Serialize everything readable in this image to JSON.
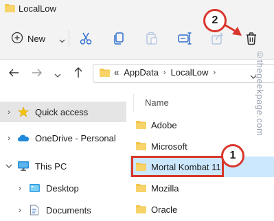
{
  "window": {
    "title": "LocalLow"
  },
  "toolbar": {
    "new_label": "New",
    "buttons": [
      "cut-icon",
      "copy-icon",
      "paste-icon",
      "rename-icon",
      "share-icon",
      "delete-icon"
    ]
  },
  "address": {
    "overflow": "«",
    "crumbs": [
      "AppData",
      "LocalLow"
    ]
  },
  "nav": {
    "items": [
      {
        "label": "Quick access",
        "icon": "star-icon",
        "selected": true
      },
      {
        "label": "OneDrive - Personal",
        "icon": "cloud-icon"
      },
      {
        "label": "This PC",
        "icon": "monitor-icon",
        "expanded": true
      },
      {
        "label": "Desktop",
        "icon": "desktop-icon"
      },
      {
        "label": "Documents",
        "icon": "documents-icon"
      }
    ]
  },
  "content": {
    "header": "Name",
    "files": [
      "Adobe",
      "Microsoft",
      "Mortal Kombat 11",
      "Mozilla",
      "Oracle"
    ],
    "selected": "Mortal Kombat 11"
  },
  "callouts": {
    "badge1": "1",
    "badge2": "2"
  },
  "watermark": "©thegeekpage.com",
  "colors": {
    "highlight": "#d9362c",
    "selection": "#cce8ff",
    "folder": "#f2c54b"
  }
}
